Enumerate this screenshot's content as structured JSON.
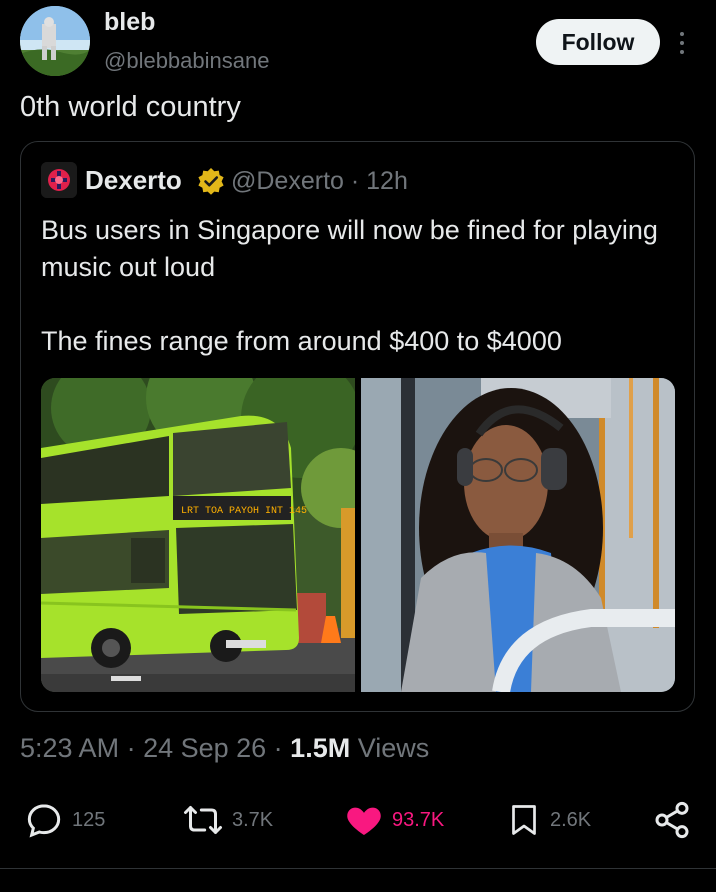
{
  "author": {
    "display_name": "bleb",
    "handle": "@blebbabinsane",
    "follow_label": "Follow"
  },
  "tweet": {
    "text": "0th world country"
  },
  "quote": {
    "display_name": "Dexerto",
    "handle_time": "@Dexerto · 12h",
    "paragraphs": [
      "Bus users in Singapore will now be fined for playing music out loud",
      "The fines range from around $400 to $4000"
    ],
    "bus_sign": "LRT TOA PAYOH INT 145"
  },
  "meta": {
    "time": "5:23 AM",
    "sep1": " · ",
    "date": "24 Sep 26",
    "sep2": " · ",
    "views_count": "1.5M",
    "views_label": " Views"
  },
  "actions": {
    "replies": "125",
    "reposts": "3.7K",
    "likes": "93.7K",
    "bookmarks": "2.6K"
  },
  "colors": {
    "background": "#000000",
    "text": "#e7e9ea",
    "muted": "#71767b",
    "like": "#f91880",
    "verified": "#e2b719",
    "bus_green": "#a6e22b"
  }
}
